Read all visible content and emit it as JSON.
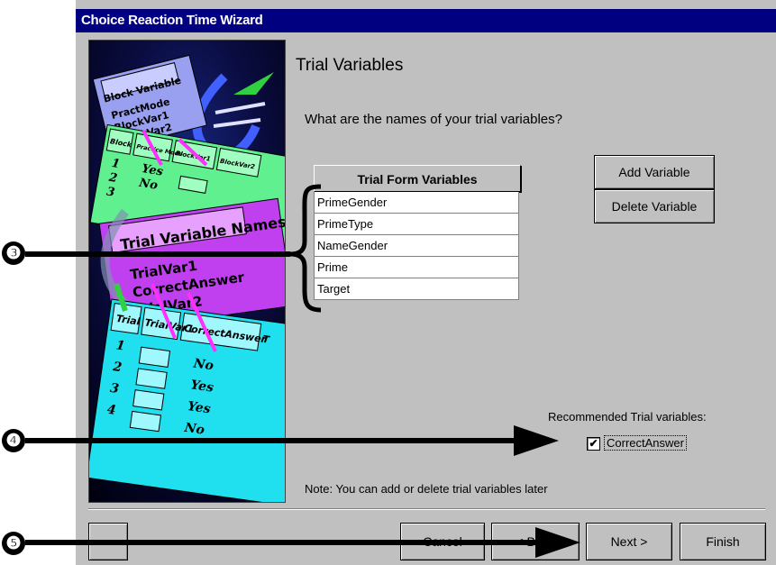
{
  "window": {
    "title": "Choice Reaction Time Wizard"
  },
  "page": {
    "heading": "Trial Variables",
    "question": "What are the names of your trial variables?"
  },
  "trial_form": {
    "header": "Trial Form Variables",
    "items": [
      "PrimeGender",
      "PrimeType",
      "NameGender",
      "Prime",
      "Target"
    ]
  },
  "buttons": {
    "add_variable": "Add Variable",
    "delete_variable": "Delete Variable",
    "cancel": "Cancel",
    "back": "< Back",
    "next": "Next >",
    "finish": "Finish"
  },
  "recommended": {
    "label": "Recommended Trial variables:",
    "items": [
      {
        "label": "CorrectAnswer",
        "checked": true
      }
    ]
  },
  "note": "Note: You can add or delete trial variables later",
  "illustration": {
    "block_card_title": "Block Variable",
    "block_items": [
      "PractMode",
      "BlockVar1",
      "BlockVar2"
    ],
    "block_table_headers": [
      "Block",
      "Practice Mode",
      "BlockVar1",
      "BlockVar2"
    ],
    "block_rows": [
      {
        "n": "1",
        "v": "Yes"
      },
      {
        "n": "2",
        "v": "No"
      },
      {
        "n": "3",
        "v": ""
      }
    ],
    "trial_names_title": "Trial Variable Names",
    "trial_names": [
      "TrialVar1",
      "CorrectAnswer",
      "TrialVar2"
    ],
    "trial_table_headers": [
      "Trial",
      "TrialVar1",
      "CorrectAnswer",
      "T"
    ],
    "trial_rows": [
      {
        "n": "1",
        "v": "No"
      },
      {
        "n": "2",
        "v": "Yes"
      },
      {
        "n": "3",
        "v": "Yes"
      },
      {
        "n": "4",
        "v": "No"
      }
    ]
  },
  "callouts": [
    "❸",
    "❹",
    "❺"
  ]
}
